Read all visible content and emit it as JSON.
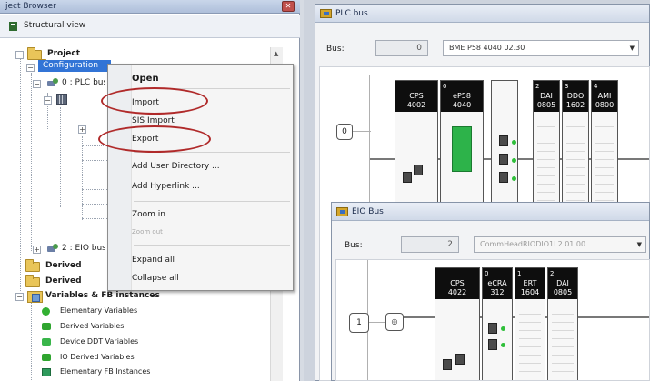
{
  "project_browser": {
    "title": "ject Browser",
    "close_glyph": "✕",
    "view_tab": "Structural view",
    "tree": {
      "project": "Project",
      "configuration": "Configuration",
      "plc_bus_node": "0 : PLC bus",
      "eio_node": "2 : EIO bus",
      "derived1": "Derived",
      "derived2": "Derived",
      "variables": "Variables & FB instances",
      "var_items": [
        "Elementary Variables",
        "Derived Variables",
        "Device DDT Variables",
        "IO Derived Variables",
        "Elementary FB Instances"
      ]
    }
  },
  "context_menu": {
    "items": [
      "Open",
      "Import",
      "SIS Import",
      "Export",
      "Add User Directory ...",
      "Add Hyperlink ...",
      "Zoom in",
      "Zoom out",
      "Expand all",
      "Collapse all"
    ],
    "highlight_color": "#b02a2a"
  },
  "plc_window": {
    "title": "PLC bus",
    "bus_label": "Bus:",
    "bus_number": "0",
    "bus_model": "BME P58 4040  02.30",
    "modules": [
      {
        "slot": "",
        "name": "CPS",
        "ref": "4002"
      },
      {
        "slot": "0",
        "name": "eP58",
        "ref": "4040"
      },
      {
        "slot": "2",
        "name": "DAI",
        "ref": "0805"
      },
      {
        "slot": "3",
        "name": "DDO",
        "ref": "1602"
      },
      {
        "slot": "4",
        "name": "AMI",
        "ref": "0800"
      }
    ],
    "rack_number": "0"
  },
  "eio_window": {
    "title": "EIO Bus",
    "bus_label": "Bus:",
    "bus_number": "2",
    "bus_model": "CommHeadRIODIO1L2  01.00",
    "modules": [
      {
        "slot": "",
        "name": "CPS",
        "ref": "4022"
      },
      {
        "slot": "0",
        "name": "eCRA",
        "ref": "312"
      },
      {
        "slot": "1",
        "name": "ERT",
        "ref": "1604"
      },
      {
        "slot": "2",
        "name": "DAI",
        "ref": "0805"
      }
    ],
    "rack_number": "1"
  }
}
